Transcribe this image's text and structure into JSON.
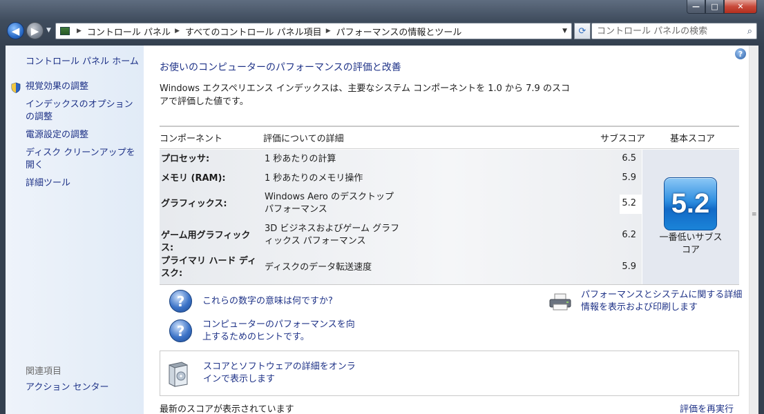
{
  "window": {
    "caption_buttons": {
      "minimize": "—",
      "maximize": "□",
      "close": "✕"
    }
  },
  "nav": {
    "back_icon": "◀",
    "forward_icon": "▶",
    "dropdown_icon": "▼",
    "breadcrumbs": [
      "コントロール パネル",
      "すべてのコントロール パネル項目",
      "パフォーマンスの情報とツール"
    ],
    "crumb_separator": "▶",
    "refresh_icon": "⟳",
    "search_placeholder": "コントロール パネルの検索",
    "search_icon": "⌕"
  },
  "sidebar": {
    "home": "コントロール パネル ホーム",
    "links": [
      "視覚効果の調整",
      "インデックスのオプションの調整",
      "電源設定の調整",
      "ディスク クリーンアップを開く",
      "詳細ツール"
    ],
    "related_heading": "関連項目",
    "related_links": [
      "アクション センター"
    ]
  },
  "main": {
    "help_icon": "?",
    "title": "お使いのコンピューターのパフォーマンスの評価と改善",
    "intro": "Windows エクスペリエンス インデックスは、主要なシステム コンポーネントを 1.0 から 7.9 のスコアで評価した値です。",
    "table": {
      "headers": {
        "component": "コンポーネント",
        "details": "評価についての詳細",
        "subscore": "サブスコア",
        "basescore": "基本スコア"
      },
      "rows": [
        {
          "component": "プロセッサ:",
          "details": "1 秒あたりの計算",
          "subscore": "6.5"
        },
        {
          "component": "メモリ (RAM):",
          "details": "1 秒あたりのメモリ操作",
          "subscore": "5.9"
        },
        {
          "component": "グラフィックス:",
          "details": "Windows Aero のデスクトップ パフォーマンス",
          "subscore": "5.2"
        },
        {
          "component": "ゲーム用グラフィックス:",
          "details": "3D ビジネスおよびゲーム グラフィックス パフォーマンス",
          "subscore": "6.2"
        },
        {
          "component": "プライマリ ハード ディスク:",
          "details": "ディスクのデータ転送速度",
          "subscore": "5.9"
        }
      ],
      "base_score": "5.2",
      "base_caption": "一番低いサブスコア"
    },
    "links": {
      "what_numbers_mean": "これらの数字の意味は何ですか?",
      "improve_tips": "コンピューターのパフォーマンスを向上するためのヒントです。",
      "print_details": "パフォーマンスとシステムに関する詳細情報を表示および印刷します",
      "online_details": "スコアとソフトウェアの詳細をオンラインで表示します"
    },
    "question_icon": "?",
    "bottom_status": "最新のスコアが表示されています",
    "rerun_link": "評価を再実行"
  },
  "colors": {
    "link": "#1e3287",
    "sidebar_bg": "#e1ebf7",
    "score_tile": "#2e8ee0"
  }
}
